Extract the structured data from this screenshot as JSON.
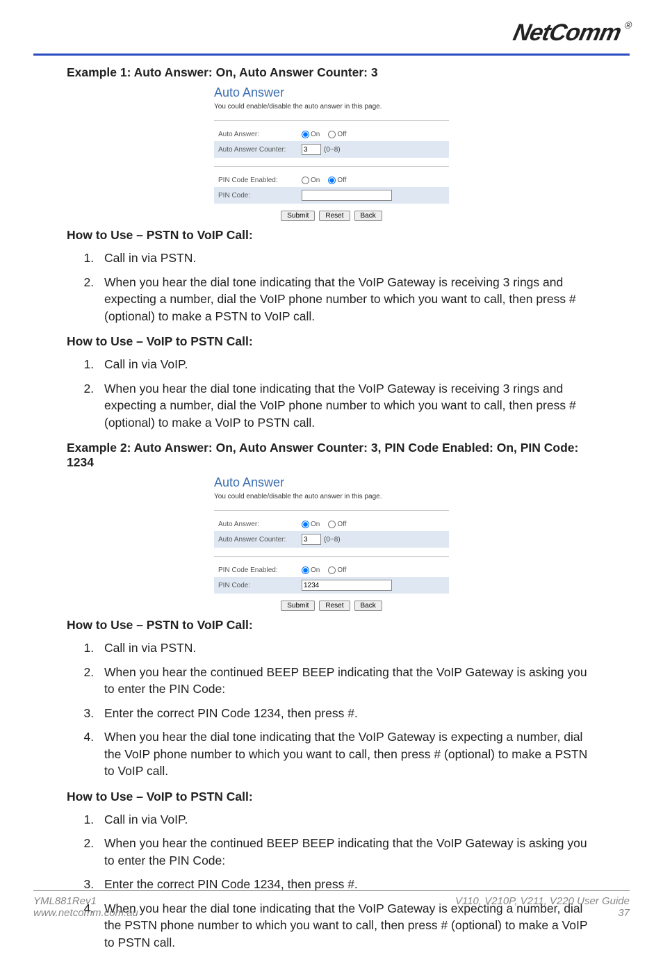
{
  "brand": "NetComm",
  "example1": {
    "heading": "Example 1: Auto Answer: On, Auto Answer Counter: 3",
    "panel": {
      "title": "Auto Answer",
      "subtitle": "You could enable/disable the auto answer in this page.",
      "auto_answer_label": "Auto Answer:",
      "auto_answer_on": "On",
      "auto_answer_off": "Off",
      "auto_answer_value": "on",
      "counter_label": "Auto Answer Counter:",
      "counter_value": "3",
      "counter_hint": "(0~8)",
      "pin_enabled_label": "PIN Code Enabled:",
      "pin_enabled_value": "off",
      "pin_code_label": "PIN Code:",
      "pin_code_value": "",
      "btn_submit": "Submit",
      "btn_reset": "Reset",
      "btn_back": "Back"
    },
    "pstn_to_voip": {
      "title": "How to Use – PSTN to VoIP Call:",
      "steps": [
        "Call in via PSTN.",
        "When you hear the dial tone indicating that the VoIP Gateway is receiving 3 rings and expecting a number, dial the VoIP phone number to which you want to call, then press # (optional) to make a PSTN to VoIP call."
      ]
    },
    "voip_to_pstn": {
      "title": "How to Use – VoIP to PSTN Call:",
      "steps": [
        "Call in via VoIP.",
        "When you hear the dial tone indicating that the VoIP Gateway is receiving 3 rings and expecting a number, dial the VoIP phone number to which you want to call, then press # (optional) to make a VoIP to PSTN call."
      ]
    }
  },
  "example2": {
    "heading": "Example 2: Auto Answer: On, Auto Answer Counter: 3, PIN Code Enabled: On, PIN Code: 1234",
    "panel": {
      "title": "Auto Answer",
      "subtitle": "You could enable/disable the auto answer in this page.",
      "auto_answer_label": "Auto Answer:",
      "auto_answer_on": "On",
      "auto_answer_off": "Off",
      "auto_answer_value": "on",
      "counter_label": "Auto Answer Counter:",
      "counter_value": "3",
      "counter_hint": "(0~8)",
      "pin_enabled_label": "PIN Code Enabled:",
      "pin_enabled_value": "on",
      "pin_code_label": "PIN Code:",
      "pin_code_value": "1234",
      "btn_submit": "Submit",
      "btn_reset": "Reset",
      "btn_back": "Back"
    },
    "pstn_to_voip": {
      "title": "How to Use – PSTN to VoIP Call:",
      "steps": [
        "Call in via PSTN.",
        "When you hear the continued BEEP BEEP indicating that the VoIP Gateway is asking you to enter the PIN Code:",
        "Enter the correct PIN Code 1234, then press #.",
        "When you hear the dial tone indicating that the VoIP Gateway is expecting a number, dial the VoIP phone number to which you want to call, then press # (optional) to make a PSTN to VoIP call."
      ]
    },
    "voip_to_pstn": {
      "title": "How to Use – VoIP to PSTN Call:",
      "steps": [
        "Call in via VoIP.",
        "When you hear the continued BEEP BEEP indicating that the VoIP Gateway is asking you to enter the PIN Code:",
        "Enter the correct PIN Code 1234, then press #.",
        "When you hear the dial tone indicating that the VoIP Gateway is expecting a number, dial the PSTN phone number to which you want to call, then press # (optional) to make a VoIP to PSTN call."
      ]
    }
  },
  "footer": {
    "left_top": "YML881Rev1",
    "left_bottom": "www.netcomm.com.au",
    "right_top": "V110, V210P, V211, V220 User Guide",
    "right_bottom": "37"
  }
}
